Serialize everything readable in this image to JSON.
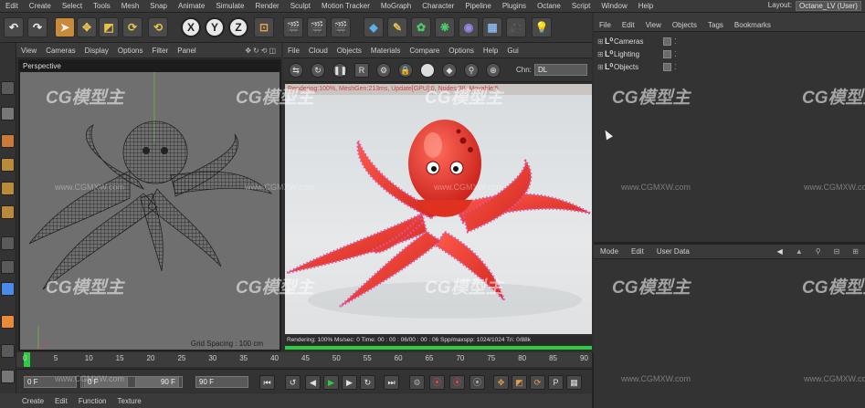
{
  "app": {
    "menu": [
      "Edit",
      "Create",
      "Select",
      "Tools",
      "Mesh",
      "Snap",
      "Animate",
      "Simulate",
      "Render",
      "Sculpt",
      "Motion Tracker",
      "MoGraph",
      "Character",
      "Pipeline",
      "Plugins",
      "Octane",
      "Script",
      "Window",
      "Help"
    ],
    "layout_label": "Layout:",
    "layout_value": "Octane_LV (User)"
  },
  "toolbar": {
    "axis_buttons": [
      "X",
      "Y",
      "Z"
    ]
  },
  "viewport": {
    "menu": [
      "View",
      "Cameras",
      "Display",
      "Options",
      "Filter",
      "Panel"
    ],
    "label": "Perspective",
    "grid_spacing": "Grid Spacing : 100 cm"
  },
  "render_view": {
    "menu": [
      "File",
      "Cloud",
      "Objects",
      "Materials",
      "Compare",
      "Options",
      "Help",
      "Gui"
    ],
    "tool_glyphs": [
      "↻",
      "■",
      "R",
      "⚙",
      "🔒",
      "●",
      "◆",
      "⚲"
    ],
    "chn_label": "Chn:",
    "chn_value": "DL",
    "stats_line": "Rendering:100%, MeshGen:213ms, Update[GPU]:0, Nodes:38, Movable:5",
    "status_line": "Rendering: 100%  Ms/sec: 0   Time: 00 : 00 : 06/00 : 00 : 06   Spp/maxspp: 1024/1024   Tri: 0/88k",
    "progress_fraction": 1.0
  },
  "object_manager": {
    "menu": [
      "File",
      "Edit",
      "View",
      "Objects",
      "Tags",
      "Bookmarks"
    ],
    "objects": [
      "Cameras",
      "Lighting",
      "Objects"
    ]
  },
  "attribute_manager": {
    "menu": [
      "Mode",
      "Edit",
      "User Data"
    ]
  },
  "timeline": {
    "ticks": [
      "0",
      "5",
      "10",
      "15",
      "20",
      "25",
      "30",
      "35",
      "40",
      "45",
      "50",
      "55",
      "60",
      "65",
      "70",
      "75",
      "80",
      "85",
      "90"
    ],
    "current_frame_fraction": 0.0
  },
  "transport": {
    "start_field": "0 F",
    "min_field": "0 F",
    "max_field": "90 F",
    "end_field": "90 F"
  },
  "material_manager": {
    "menu": [
      "Create",
      "Edit",
      "Function",
      "Texture"
    ]
  },
  "watermarks": {
    "logo_text": "CG模型主",
    "url_text": "www.CGMXW.com"
  }
}
